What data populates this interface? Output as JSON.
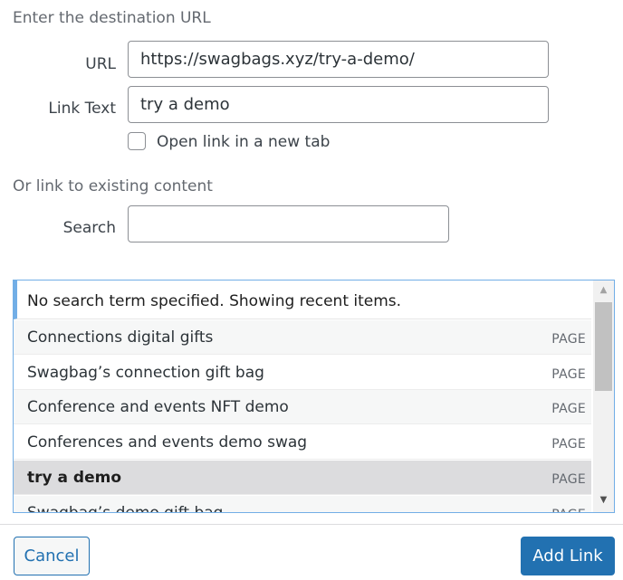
{
  "url_section": {
    "title": "Enter the destination URL",
    "url_label": "URL",
    "url_value": "https://swagbags.xyz/try-a-demo/",
    "link_text_label": "Link Text",
    "link_text_value": "try a demo",
    "new_tab_label": "Open link in a new tab",
    "new_tab_checked": false
  },
  "existing_section": {
    "title": "Or link to existing content",
    "search_label": "Search",
    "search_value": ""
  },
  "results": {
    "header": "No search term specified. Showing recent items.",
    "items": [
      {
        "title": "Connections digital gifts",
        "type": "PAGE"
      },
      {
        "title": "Swagbag’s connection gift bag",
        "type": "PAGE"
      },
      {
        "title": "Conference and events NFT demo",
        "type": "PAGE"
      },
      {
        "title": "Conferences and events demo swag",
        "type": "PAGE"
      },
      {
        "title": "try a demo",
        "type": "PAGE"
      },
      {
        "title": "Swagbag’s demo gift bag",
        "type": "PAGE"
      }
    ],
    "selected_index": 4
  },
  "footer": {
    "cancel_label": "Cancel",
    "add_link_label": "Add Link"
  },
  "colors": {
    "accent": "#2271b1",
    "focus_border": "#72aee6",
    "selected_row": "#dcdcde"
  },
  "icons": {
    "scroll_up": "triangle-up",
    "scroll_down": "triangle-down"
  }
}
